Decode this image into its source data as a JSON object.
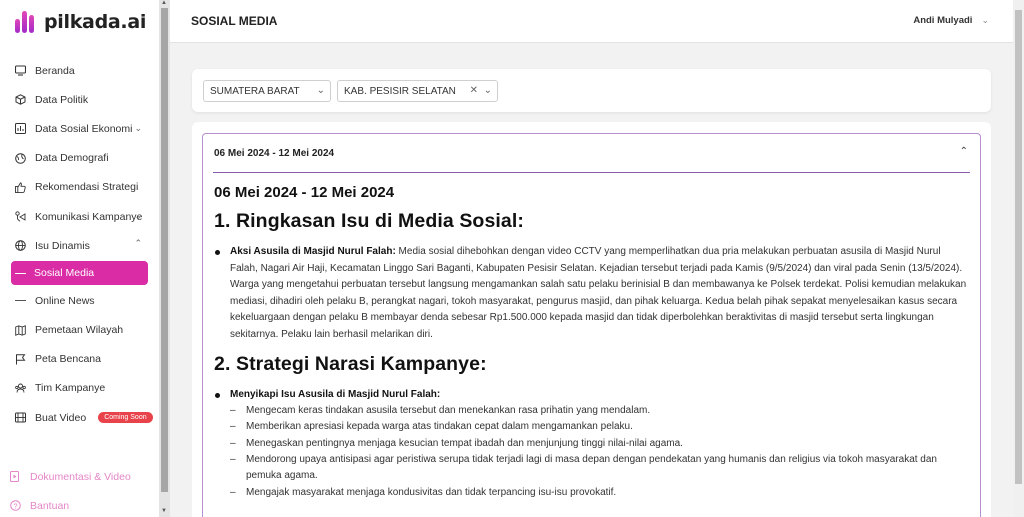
{
  "brand": {
    "name": "pilkada.ai",
    "accent": "#d92ca5"
  },
  "sidebar": {
    "items": [
      {
        "label": "Beranda",
        "icon": "monitor-icon"
      },
      {
        "label": "Data Politik",
        "icon": "cube-icon"
      },
      {
        "label": "Data Sosial Ekonomi",
        "icon": "chart-icon",
        "expandable": true
      },
      {
        "label": "Data Demografi",
        "icon": "globe-icon"
      },
      {
        "label": "Rekomendasi Strategi",
        "icon": "thumbs-up-icon"
      },
      {
        "label": "Komunikasi Kampanye",
        "icon": "megaphone-icon",
        "expandable": true
      },
      {
        "label": "Isu Dinamis",
        "icon": "globe-icon",
        "expanded": true
      },
      {
        "label": "Sosial Media",
        "active": true
      },
      {
        "label": "Online News"
      },
      {
        "label": "Pemetaan Wilayah",
        "icon": "map-icon"
      },
      {
        "label": "Peta Bencana",
        "icon": "flag-icon"
      },
      {
        "label": "Tim Kampanye",
        "icon": "users-icon"
      },
      {
        "label": "Buat Video",
        "icon": "film-icon",
        "badge": "Coming Soon"
      }
    ],
    "bottom": [
      {
        "label": "Dokumentasi & Video",
        "icon": "doc-video-icon"
      },
      {
        "label": "Bantuan",
        "icon": "help-icon"
      }
    ]
  },
  "header": {
    "title": "SOSIAL MEDIA",
    "user": "Andi Mulyadi"
  },
  "filters": {
    "province": "SUMATERA BARAT",
    "regency": "KAB. PESISIR SELATAN"
  },
  "report": {
    "accordion_title": "06 Mei 2024 - 12 Mei 2024",
    "date_heading": "06 Mei 2024 - 12 Mei 2024",
    "section1_title": "1. Ringkasan Isu di Media Sosial:",
    "issue_title": "Aksi Asusila di Masjid Nurul Falah:",
    "issue_text": " Media sosial dihebohkan dengan video CCTV yang memperlihatkan dua pria melakukan perbuatan asusila di Masjid Nurul Falah, Nagari Air Haji, Kecamatan Linggo Sari Baganti, Kabupaten Pesisir Selatan. Kejadian tersebut terjadi pada Kamis (9/5/2024) dan viral pada Senin (13/5/2024). Warga yang mengetahui perbuatan tersebut langsung mengamankan salah satu pelaku berinisial B dan membawanya ke Polsek terdekat. Polisi kemudian melakukan mediasi, dihadiri oleh pelaku B, perangkat nagari, tokoh masyarakat, pengurus masjid, dan pihak keluarga. Kedua belah pihak sepakat menyelesaikan kasus secara kekeluargaan dengan pelaku B membayar denda sebesar Rp1.500.000 kepada masjid dan tidak diperbolehkan beraktivitas di masjid tersebut serta lingkungan sekitarnya. Pelaku lain berhasil melarikan diri.",
    "section2_title": "2. Strategi Narasi Kampanye:",
    "strategy_title": "Menyikapi Isu Asusila di Masjid Nurul Falah:",
    "strategy_points": [
      "Mengecam keras tindakan asusila tersebut dan menekankan rasa prihatin yang mendalam.",
      "Memberikan apresiasi kepada warga atas tindakan cepat dalam mengamankan pelaku.",
      "Menegaskan pentingnya menjaga kesucian tempat ibadah dan menjunjung tinggi nilai-nilai agama.",
      "Mendorong upaya antisipasi agar peristiwa serupa tidak terjadi lagi di masa depan dengan pendekatan yang humanis dan religius via tokoh masyarakat dan pemuka agama.",
      "Mengajak masyarakat menjaga kondusivitas dan tidak terpancing isu-isu provokatif."
    ]
  }
}
